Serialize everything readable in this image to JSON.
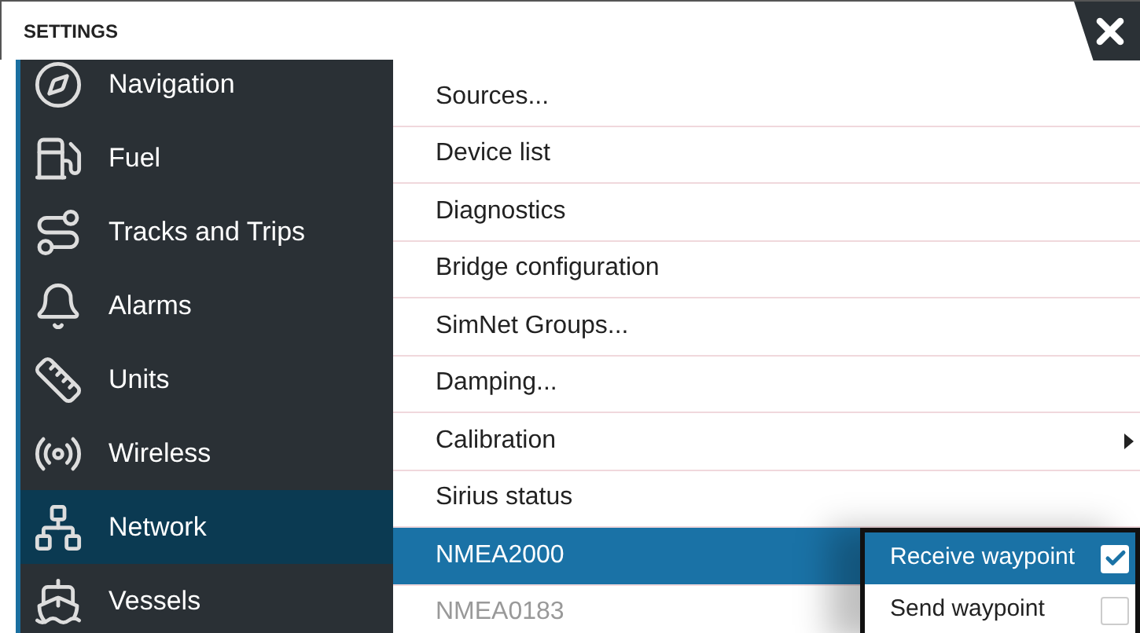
{
  "window": {
    "title": "SETTINGS"
  },
  "sidebar": {
    "items": [
      {
        "label": "Navigation",
        "selected": false
      },
      {
        "label": "Fuel",
        "selected": false
      },
      {
        "label": "Tracks and Trips",
        "selected": false
      },
      {
        "label": "Alarms",
        "selected": false
      },
      {
        "label": "Units",
        "selected": false
      },
      {
        "label": "Wireless",
        "selected": false
      },
      {
        "label": "Network",
        "selected": true
      },
      {
        "label": "Vessels",
        "selected": false
      }
    ]
  },
  "menu": {
    "items": [
      {
        "label": "Sources...",
        "selected": false,
        "disabled": false,
        "submenu": false
      },
      {
        "label": "Device list",
        "selected": false,
        "disabled": false,
        "submenu": false
      },
      {
        "label": "Diagnostics",
        "selected": false,
        "disabled": false,
        "submenu": false
      },
      {
        "label": "Bridge configuration",
        "selected": false,
        "disabled": false,
        "submenu": false
      },
      {
        "label": "SimNet Groups...",
        "selected": false,
        "disabled": false,
        "submenu": false
      },
      {
        "label": "Damping...",
        "selected": false,
        "disabled": false,
        "submenu": false
      },
      {
        "label": "Calibration",
        "selected": false,
        "disabled": false,
        "submenu": true
      },
      {
        "label": "Sirius status",
        "selected": false,
        "disabled": false,
        "submenu": false
      },
      {
        "label": "NMEA2000",
        "selected": true,
        "disabled": false,
        "submenu": false
      },
      {
        "label": "NMEA0183",
        "selected": false,
        "disabled": true,
        "submenu": false
      }
    ]
  },
  "popup": {
    "options": [
      {
        "label": "Receive waypoint",
        "selected": true,
        "checked": true
      },
      {
        "label": "Send waypoint",
        "selected": false,
        "checked": false
      }
    ]
  }
}
